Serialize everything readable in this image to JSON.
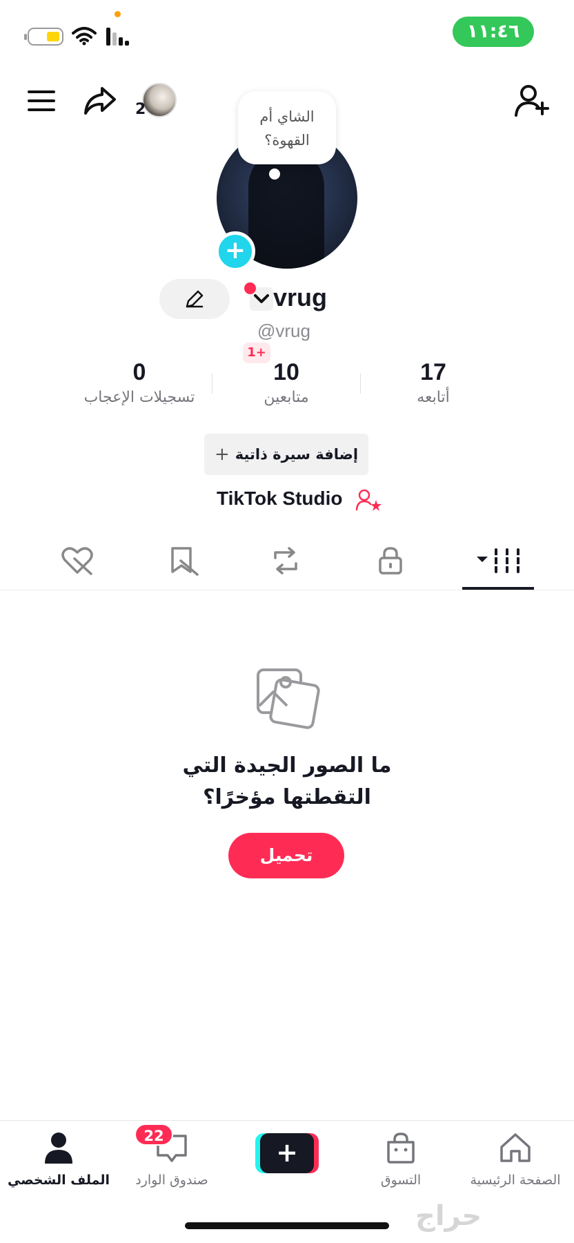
{
  "status_bar": {
    "time": "١١:٤٦",
    "battery_color": "#ffd60a",
    "time_pill_color": "#34c759"
  },
  "header": {
    "story_count": "2"
  },
  "note": {
    "text_line1": "الشاي أم",
    "text_line2": "القهوة؟"
  },
  "profile": {
    "username": "vrug",
    "handle": "@vrug",
    "new_followers_badge": "1+"
  },
  "stats": [
    {
      "value": "0",
      "label": "تسجيلات الإعجاب"
    },
    {
      "value": "10",
      "label": "متابعين"
    },
    {
      "value": "17",
      "label": "أتابعه"
    }
  ],
  "bio_button": {
    "label": "إضافة سيرة ذاتية"
  },
  "studio": {
    "label": "TikTok Studio"
  },
  "tabs": [
    {
      "icon": "liked-hidden-icon"
    },
    {
      "icon": "saved-hidden-icon"
    },
    {
      "icon": "repost-icon"
    },
    {
      "icon": "lock-icon"
    },
    {
      "icon": "grid-icon",
      "active": true
    }
  ],
  "empty_state": {
    "title_line1": "ما الصور الجيدة التي",
    "title_line2": "التقطتها مؤخرًا؟",
    "button": "تحميل"
  },
  "bottom_nav": {
    "profile": "الملف الشخصي",
    "inbox": "صندوق الوارد",
    "inbox_badge": "22",
    "shop": "التسوق",
    "home": "الصفحة الرئيسية"
  },
  "watermark": "حراج",
  "colors": {
    "accent": "#fe2c55",
    "cyan": "#25f4ee",
    "dark": "#161823"
  }
}
